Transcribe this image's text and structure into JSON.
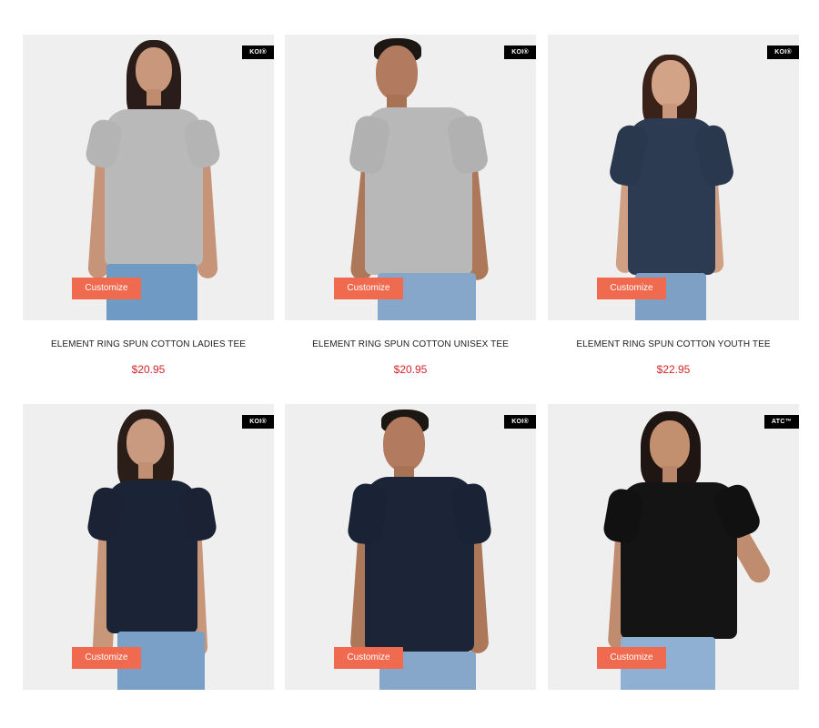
{
  "customize_label": "Customize",
  "products": [
    {
      "title": "ELEMENT RING SPUN COTTON LADIES TEE",
      "price": "$20.95",
      "badge": "KOI®",
      "shirt_color": "#b9b9b9",
      "image_icon": "woman-model-gray-tee"
    },
    {
      "title": "ELEMENT RING SPUN COTTON UNISEX TEE",
      "price": "$20.95",
      "badge": "KOI®",
      "shirt_color": "#b8b8b8",
      "image_icon": "man-model-gray-tee"
    },
    {
      "title": "ELEMENT RING SPUN COTTON YOUTH TEE",
      "price": "$22.95",
      "badge": "KOI®",
      "shirt_color": "#2c3b52",
      "image_icon": "girl-model-navy-tee"
    },
    {
      "title": "",
      "price": "",
      "badge": "KOI®",
      "shirt_color": "#1b2436",
      "image_icon": "woman-model-navy-tee"
    },
    {
      "title": "",
      "price": "",
      "badge": "KOI®",
      "shirt_color": "#1c2538",
      "image_icon": "man-model-navy-tee"
    },
    {
      "title": "",
      "price": "",
      "badge": "ATC™",
      "shirt_color": "#141414",
      "image_icon": "woman-model-black-tee"
    }
  ],
  "colors": {
    "accent": "#ef6a4f",
    "price": "#d2262b",
    "badge_bg": "#000000"
  }
}
